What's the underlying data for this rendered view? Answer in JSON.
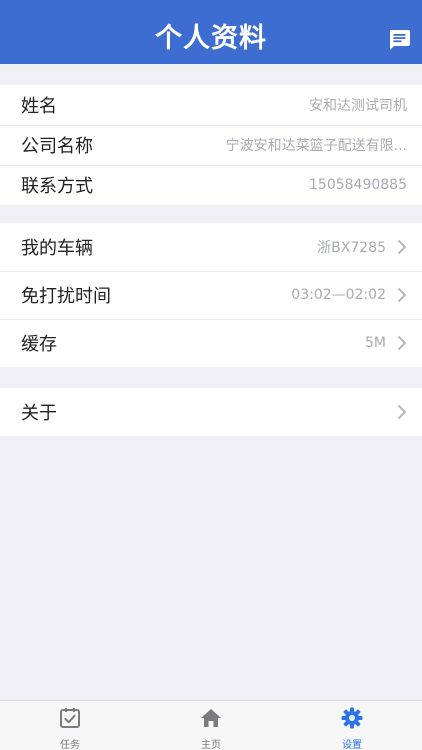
{
  "header": {
    "title": "个人资料",
    "message_icon": "message-icon"
  },
  "profile": {
    "name_label": "姓名",
    "name_value": "安和达测试司机",
    "company_label": "公司名称",
    "company_value": "宁波安和达菜篮子配送有限...",
    "contact_label": "联系方式",
    "contact_value": "15058490885"
  },
  "settings": {
    "vehicle_label": "我的车辆",
    "vehicle_value": "浙BX7285",
    "dnd_label": "免打扰时间",
    "dnd_value": "03:02—02:02",
    "cache_label": "缓存",
    "cache_value": "5M"
  },
  "about": {
    "label": "关于"
  },
  "tabbar": {
    "tabs": [
      {
        "label": "任务",
        "icon": "task-icon"
      },
      {
        "label": "主页",
        "icon": "home-icon"
      },
      {
        "label": "设置",
        "icon": "gear-icon"
      }
    ],
    "active_index": 2
  },
  "colors": {
    "header": "#3d6dd1",
    "active": "#2f73e8",
    "inactive": "#7a7a7f",
    "background": "#efeff4"
  }
}
